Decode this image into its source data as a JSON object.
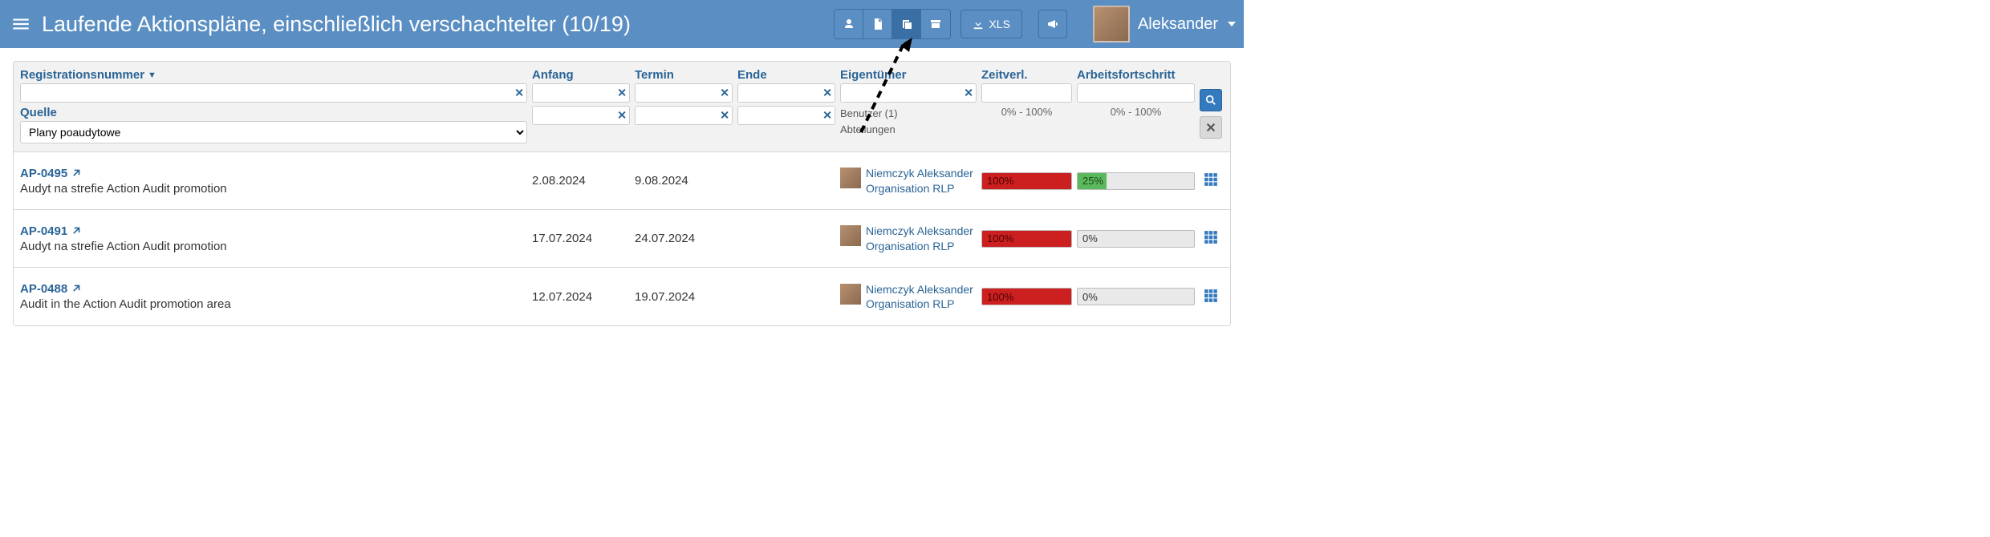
{
  "header": {
    "title": "Laufende Aktionspläne, einschließlich verschachtelter (10/19)",
    "xls_label": "XLS",
    "user_name": "Aleksander"
  },
  "filters": {
    "reg_label": "Registrationsnummer",
    "quelle_label": "Quelle",
    "quelle_value": "Plany poaudytowe",
    "anfang_label": "Anfang",
    "termin_label": "Termin",
    "ende_label": "Ende",
    "owner_label": "Eigentümer",
    "owner_hint1": "Benutzer (1)",
    "owner_hint2": "Abteilungen",
    "zeitverl_label": "Zeitverl.",
    "progress_label": "Arbeitsfortschritt",
    "pct_range": "0% - 100%"
  },
  "rows": [
    {
      "id": "AP-0495",
      "desc": "Audyt na strefie Action Audit promotion",
      "anfang": "2.08.2024",
      "termin": "9.08.2024",
      "ende": "",
      "owner_name": "Niemczyk Aleksander",
      "owner_org": "Organisation RLP",
      "timepass_pct": 100,
      "timepass_label": "100%",
      "progress_pct": 25,
      "progress_label": "25%",
      "progress_color": "green"
    },
    {
      "id": "AP-0491",
      "desc": "Audyt na strefie Action Audit promotion",
      "anfang": "17.07.2024",
      "termin": "24.07.2024",
      "ende": "",
      "owner_name": "Niemczyk Aleksander",
      "owner_org": "Organisation RLP",
      "timepass_pct": 100,
      "timepass_label": "100%",
      "progress_pct": 0,
      "progress_label": "0%",
      "progress_color": "none"
    },
    {
      "id": "AP-0488",
      "desc": "Audit in the Action Audit promotion area",
      "anfang": "12.07.2024",
      "termin": "19.07.2024",
      "ende": "",
      "owner_name": "Niemczyk Aleksander",
      "owner_org": "Organisation RLP",
      "timepass_pct": 100,
      "timepass_label": "100%",
      "progress_pct": 0,
      "progress_label": "0%",
      "progress_color": "none"
    }
  ]
}
